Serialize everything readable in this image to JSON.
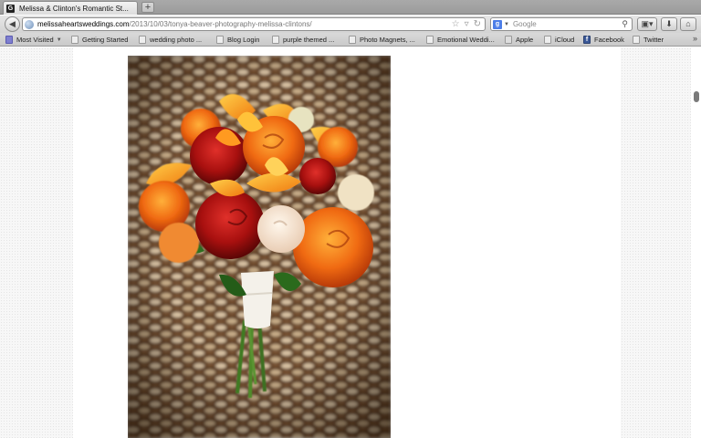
{
  "browser": {
    "tab": {
      "favicon_letter": "G",
      "title": "Melissa & Clinton's Romantic St..."
    },
    "new_tab_label": "+",
    "nav": {
      "back_label": "◀"
    },
    "url": {
      "host": "melissaheartsweddings.com",
      "path": "/2013/10/03/tonya-beaver-photography-melissa-clintons/"
    },
    "search": {
      "engine_letter": "g",
      "placeholder": "Google"
    },
    "toolbar": {
      "downloads_label": "⬇",
      "home_label": "⌂",
      "panel_label": "▣▾"
    }
  },
  "bookmarks": [
    {
      "label": "Most Visited",
      "icon": "most-visited-icon"
    },
    {
      "label": "Getting Started",
      "icon": "page-icon"
    },
    {
      "label": "wedding photo ...",
      "icon": "page-icon"
    },
    {
      "label": "Blog Login",
      "icon": "page-icon"
    },
    {
      "label": "purple themed ...",
      "icon": "page-icon"
    },
    {
      "label": "Photo Magnets, ...",
      "icon": "page-icon"
    },
    {
      "label": "Emotional Weddi...",
      "icon": "page-icon"
    },
    {
      "label": "Apple",
      "icon": "apple-icon"
    },
    {
      "label": "iCloud",
      "icon": "page-icon"
    },
    {
      "label": "Facebook",
      "icon": "facebook-icon"
    },
    {
      "label": "Twitter",
      "icon": "page-icon"
    }
  ],
  "bookmarks_overflow": "»",
  "page": {
    "photo_icon": "bouquet-photo"
  }
}
